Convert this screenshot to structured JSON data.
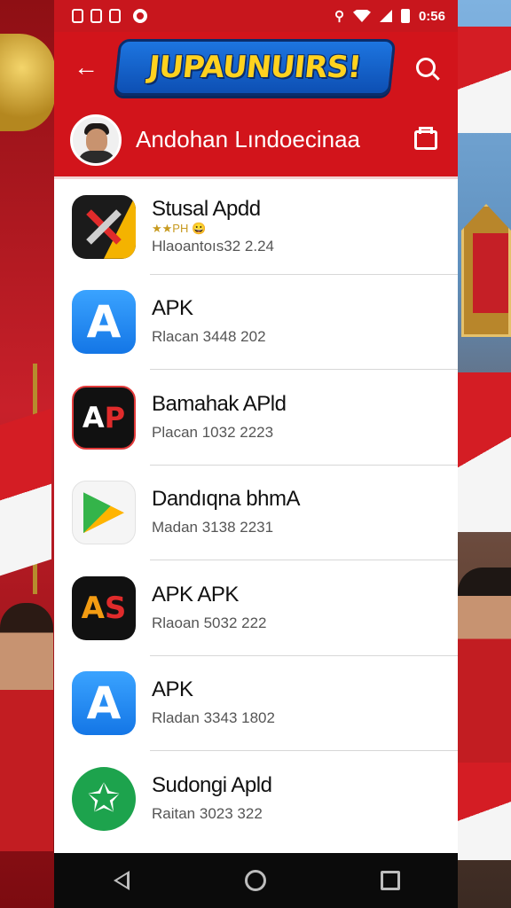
{
  "status_bar": {
    "time": "0:56",
    "left_icons": [
      "notification-icon",
      "notification-icon",
      "sim-icon",
      "record-icon"
    ],
    "right_icons": [
      "signal-icon",
      "wifi-icon",
      "cell-signal-icon",
      "battery-icon"
    ]
  },
  "app_bar": {
    "back_icon": "back-arrow-icon",
    "logo_text": "JUPAUNUIRS!",
    "search_icon": "search-icon"
  },
  "profile": {
    "name": "Andohan Lındoecinaa",
    "action_icon": "folder-icon"
  },
  "apps": [
    {
      "name": "Stusal Apdd",
      "rating": "★★PH 😀",
      "meta": "Hlaoantoıs32  2.24",
      "icon": "tools-icon"
    },
    {
      "name": "APK",
      "meta": "Rlacan 3448  202",
      "icon": "app-store-icon"
    },
    {
      "name": "Bamahak APld",
      "meta": "Placan 1032  2223",
      "icon": "ap-logo-icon"
    },
    {
      "name": "Dandıqna bhmA",
      "meta": "Madan 3138  2231",
      "icon": "play-triangle-icon"
    },
    {
      "name": "APK APK",
      "meta": "Rlaoan 5032  222",
      "icon": "as-logo-icon"
    },
    {
      "name": "APK",
      "meta": "Rladan 3343  1802",
      "icon": "app-store-icon"
    },
    {
      "name": "Sudongi Apld",
      "meta": "Raitan 3023  322",
      "icon": "star-icon"
    }
  ],
  "nav_bar": {
    "back_icon": "nav-back-icon",
    "home_icon": "nav-home-icon",
    "recents_icon": "nav-recents-icon"
  },
  "colors": {
    "primary_red": "#d2141b",
    "logo_blue": "#1d75e0",
    "logo_yellow": "#ffd21f",
    "nav_black": "#0b0b0b"
  }
}
